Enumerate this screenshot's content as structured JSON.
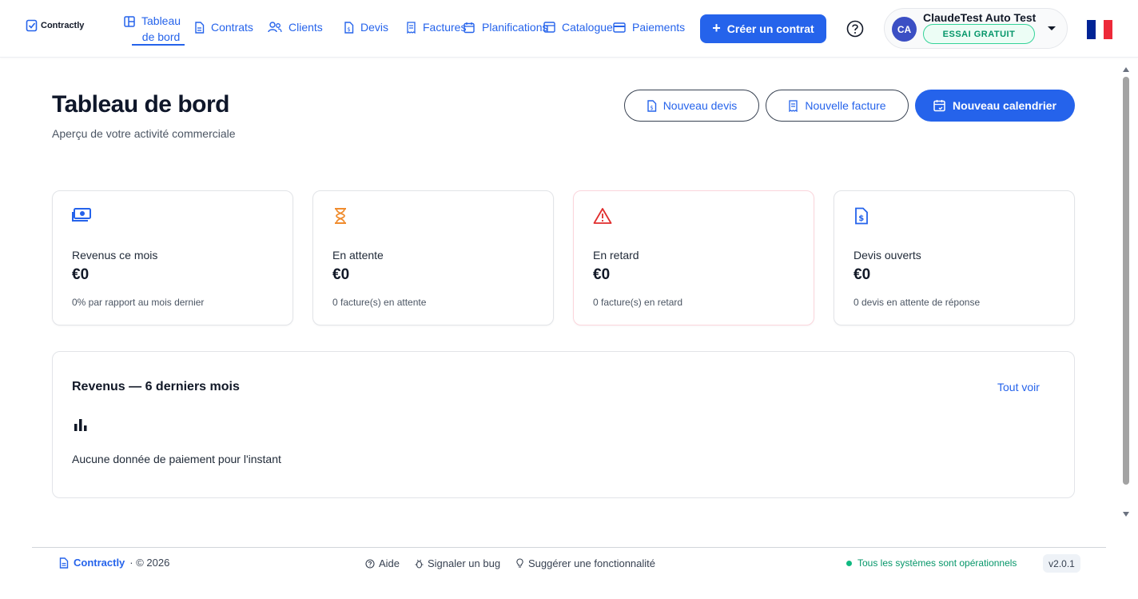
{
  "app": {
    "name": "Contractly"
  },
  "nav": {
    "items": [
      {
        "label": "Tableau",
        "label2": "de bord",
        "icon": "layout-icon",
        "active": true
      },
      {
        "label": "Contrats",
        "icon": "document-icon"
      },
      {
        "label": "Clients",
        "icon": "users-icon"
      },
      {
        "label": "Devis",
        "icon": "quote-icon"
      },
      {
        "label": "Factures",
        "icon": "receipt-icon"
      },
      {
        "label": "Planifications",
        "icon": "calendar-icon"
      },
      {
        "label": "Catalogue",
        "icon": "catalog-icon"
      },
      {
        "label": "Paiements",
        "icon": "card-icon"
      }
    ],
    "create_button": "Créer un contrat"
  },
  "user": {
    "initials": "CA",
    "name": "ClaudeTest Auto Test",
    "badge": "ESSAI GRATUIT"
  },
  "language": {
    "flag": "fr",
    "colors": [
      "#002395",
      "#ffffff",
      "#ed2939"
    ]
  },
  "page": {
    "title": "Tableau de bord",
    "subtitle": "Aperçu de votre activité commerciale",
    "actions": {
      "new_quote": "Nouveau devis",
      "new_invoice": "Nouvelle facture",
      "new_calendar": "Nouveau calendrier"
    }
  },
  "kpis": [
    {
      "icon": "money-icon",
      "label": "Revenus ce mois",
      "value": "€0",
      "note": "0% par rapport au mois dernier",
      "color": "#2563eb"
    },
    {
      "icon": "hourglass-icon",
      "label": "En attente",
      "value": "€0",
      "note": "0 facture(s) en attente",
      "color": "#f08c2e"
    },
    {
      "icon": "warning-icon",
      "label": "En retard",
      "value": "€0",
      "note": "0 facture(s) en retard",
      "color": "#e02d2d"
    },
    {
      "icon": "quote-icon",
      "label": "Devis ouverts",
      "value": "€0",
      "note": "0 devis en attente de réponse",
      "color": "#2563eb"
    }
  ],
  "revenue": {
    "title": "Revenus — 6 derniers mois",
    "link": "Tout voir",
    "empty": "Aucune donnée de paiement pour l'instant"
  },
  "footer": {
    "brand": "Contractly",
    "copyright": "· © 2026",
    "help": "Aide",
    "bug": "Signaler un bug",
    "suggest": "Suggérer une fonctionnalité",
    "status": "Tous les systèmes sont opérationnels",
    "version": "v2.0.1"
  }
}
